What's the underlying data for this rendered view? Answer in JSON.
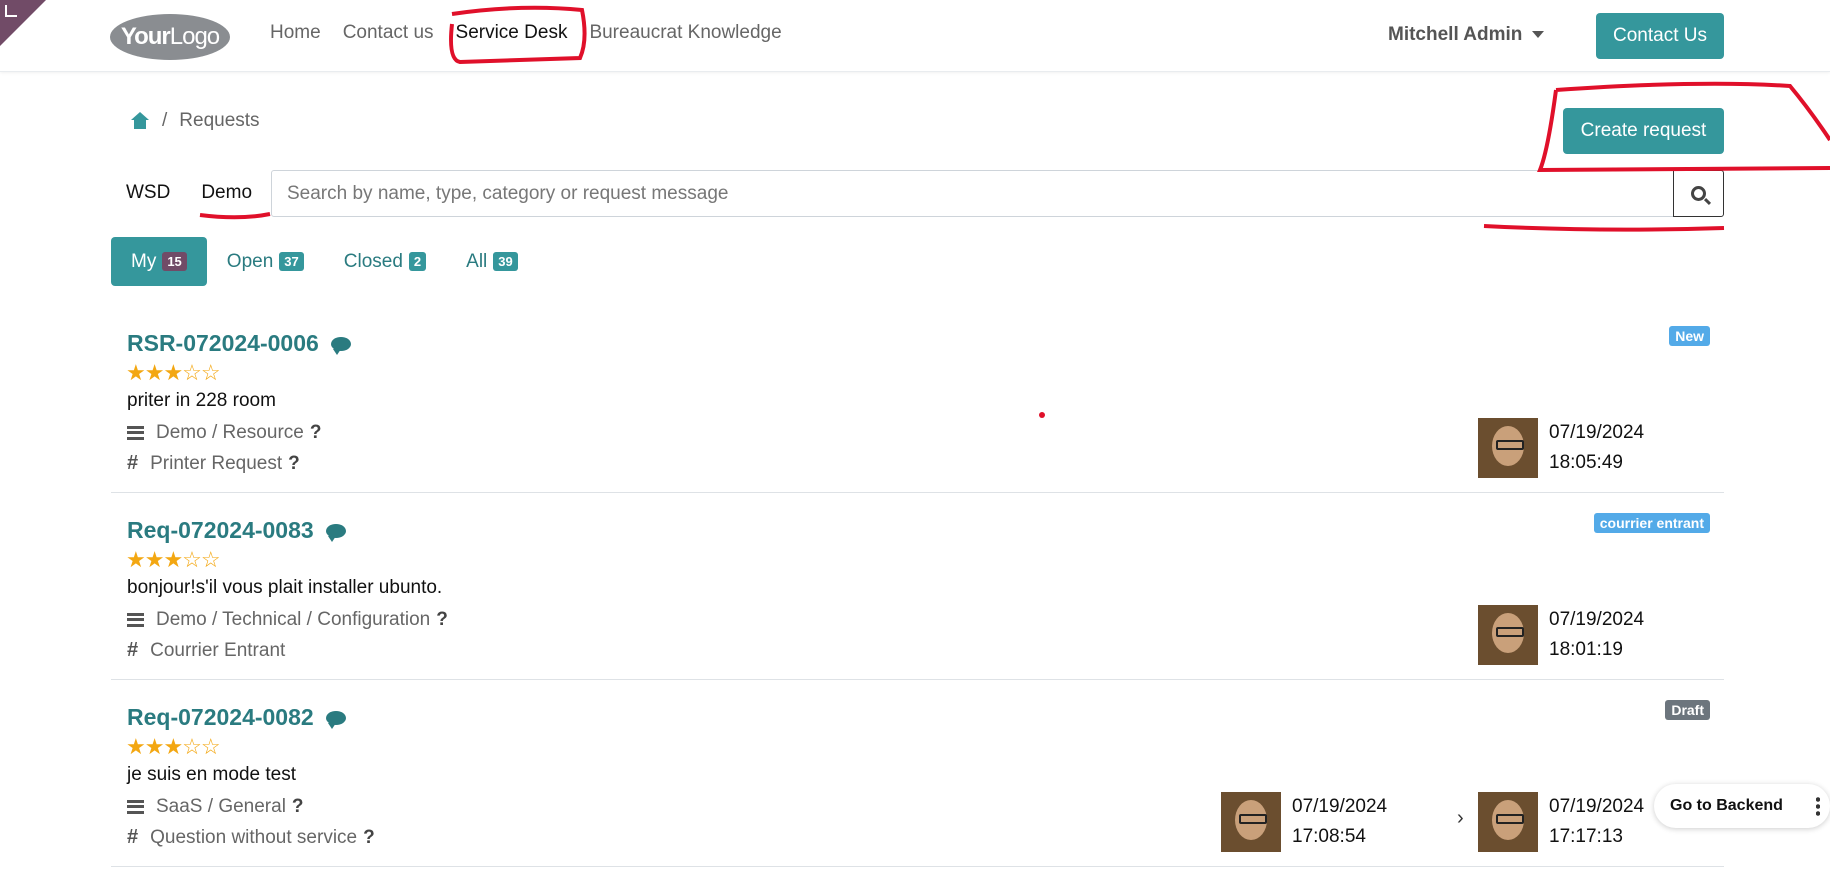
{
  "header": {
    "logo": {
      "part1": "Your",
      "part2": "Logo"
    },
    "nav": [
      "Home",
      "Contact us",
      "Service Desk",
      "Bureaucrat Knowledge"
    ],
    "active_nav": "Service Desk",
    "user_name": "Mitchell Admin",
    "contact_button": "Contact Us"
  },
  "breadcrumb": {
    "separator": "/",
    "current": "Requests"
  },
  "create_button": "Create request",
  "projects": [
    "WSD",
    "Demo"
  ],
  "search": {
    "placeholder": "Search by name, type, category or request message"
  },
  "filters": [
    {
      "label": "My",
      "count": "15"
    },
    {
      "label": "Open",
      "count": "37"
    },
    {
      "label": "Closed",
      "count": "2"
    },
    {
      "label": "All",
      "count": "39"
    }
  ],
  "requests": [
    {
      "id": "RSR-072024-0006",
      "rating": 3,
      "message": "priter in 228 room",
      "category": "Demo / Resource",
      "type": "Printer Request",
      "status": "New",
      "date": "07/19/2024",
      "time": "18:05:49"
    },
    {
      "id": "Req-072024-0083",
      "rating": 3,
      "message": "bonjour!s'il vous plait installer ubunto.",
      "category": "Demo / Technical / Configuration",
      "type": "Courrier Entrant",
      "status": "courrier entrant",
      "date": "07/19/2024",
      "time": "18:01:19"
    },
    {
      "id": "Req-072024-0082",
      "rating": 3,
      "message": "je suis en mode test",
      "category": "SaaS / General",
      "type": "Question without service",
      "status": "Draft",
      "date_from": "07/19/2024",
      "time_from": "17:08:54",
      "date": "07/19/2024",
      "time": "17:17:13"
    }
  ],
  "go_backend": "Go to Backend",
  "colors": {
    "accent": "#35979c",
    "brand": "#714b67",
    "annotation": "#e0102a",
    "star": "#f3a712"
  }
}
